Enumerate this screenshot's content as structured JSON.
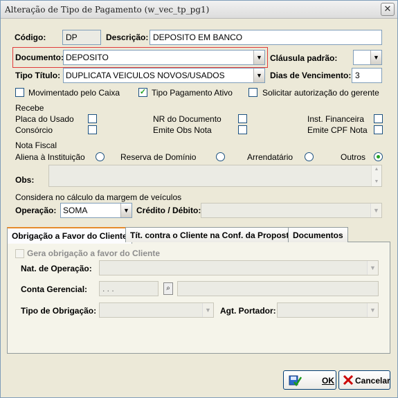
{
  "window": {
    "title": "Alteração de Tipo de Pagamento (w_vec_tp_pg1)",
    "close": "✕"
  },
  "codigo": {
    "label": "Código:",
    "value": "DP"
  },
  "descricao": {
    "label": "Descrição:",
    "value": "DEPOSITO EM BANCO"
  },
  "documento": {
    "label": "Documento:",
    "value": "DEPOSITO"
  },
  "clausula": {
    "label": "Cláusula padrão:",
    "value": ""
  },
  "tipo_titulo": {
    "label": "Tipo Título:",
    "value": "DUPLICATA VEICULOS NOVOS/USADOS"
  },
  "dias_venc": {
    "label": "Dias de Vencimento:",
    "value": "3"
  },
  "checks_row": {
    "movimentado": {
      "label": "Movimentado pelo Caixa",
      "checked": false
    },
    "tipo_pag_ativo": {
      "label": "Tipo Pagamento Ativo",
      "checked": true
    },
    "solicitar": {
      "label": "Solicitar autorização do gerente",
      "checked": false
    }
  },
  "recebe": {
    "title": "Recebe",
    "placa": "Placa do Usado",
    "consorcio": "Consórcio",
    "nr_doc": "NR do Documento",
    "emite_obs": "Emite Obs Nota",
    "inst_fin": "Inst. Financeira",
    "emite_cpf": "Emite CPF Nota"
  },
  "nota_fiscal": {
    "title": "Nota Fiscal",
    "aliena": "Aliena à Instituição",
    "reserva": "Reserva de Domínio",
    "arrendatario": "Arrendatário",
    "outros": "Outros",
    "selected": "Outros"
  },
  "obs": {
    "label": "Obs:",
    "value": ""
  },
  "considera": {
    "title": "Considera no cálculo da margem de veículos"
  },
  "operacao": {
    "label": "Operação:",
    "value": "SOMA"
  },
  "credito": {
    "label": "Crédito / Débito:",
    "value": ""
  },
  "tabs": [
    {
      "label": "Obrigação a Favor do Cliente"
    },
    {
      "label": "Tít. contra o Cliente na Conf. da Proposta"
    },
    {
      "label": "Documentos"
    }
  ],
  "tab1": {
    "gera": "Gera obrigação a favor do Cliente",
    "nat_op": "Nat. de Operação:",
    "conta_ger": "Conta Gerencial:",
    "conta_mask": " .  .  .",
    "tipo_obr": "Tipo de Obrigação:",
    "agt_port": "Agt. Portador:"
  },
  "buttons": {
    "ok": "OK",
    "cancelar": "Cancelar"
  },
  "colors": {
    "accent": "#e68b2c",
    "check": "#21a121",
    "border": "#7f9db9",
    "highlight": "#e03a3a"
  }
}
